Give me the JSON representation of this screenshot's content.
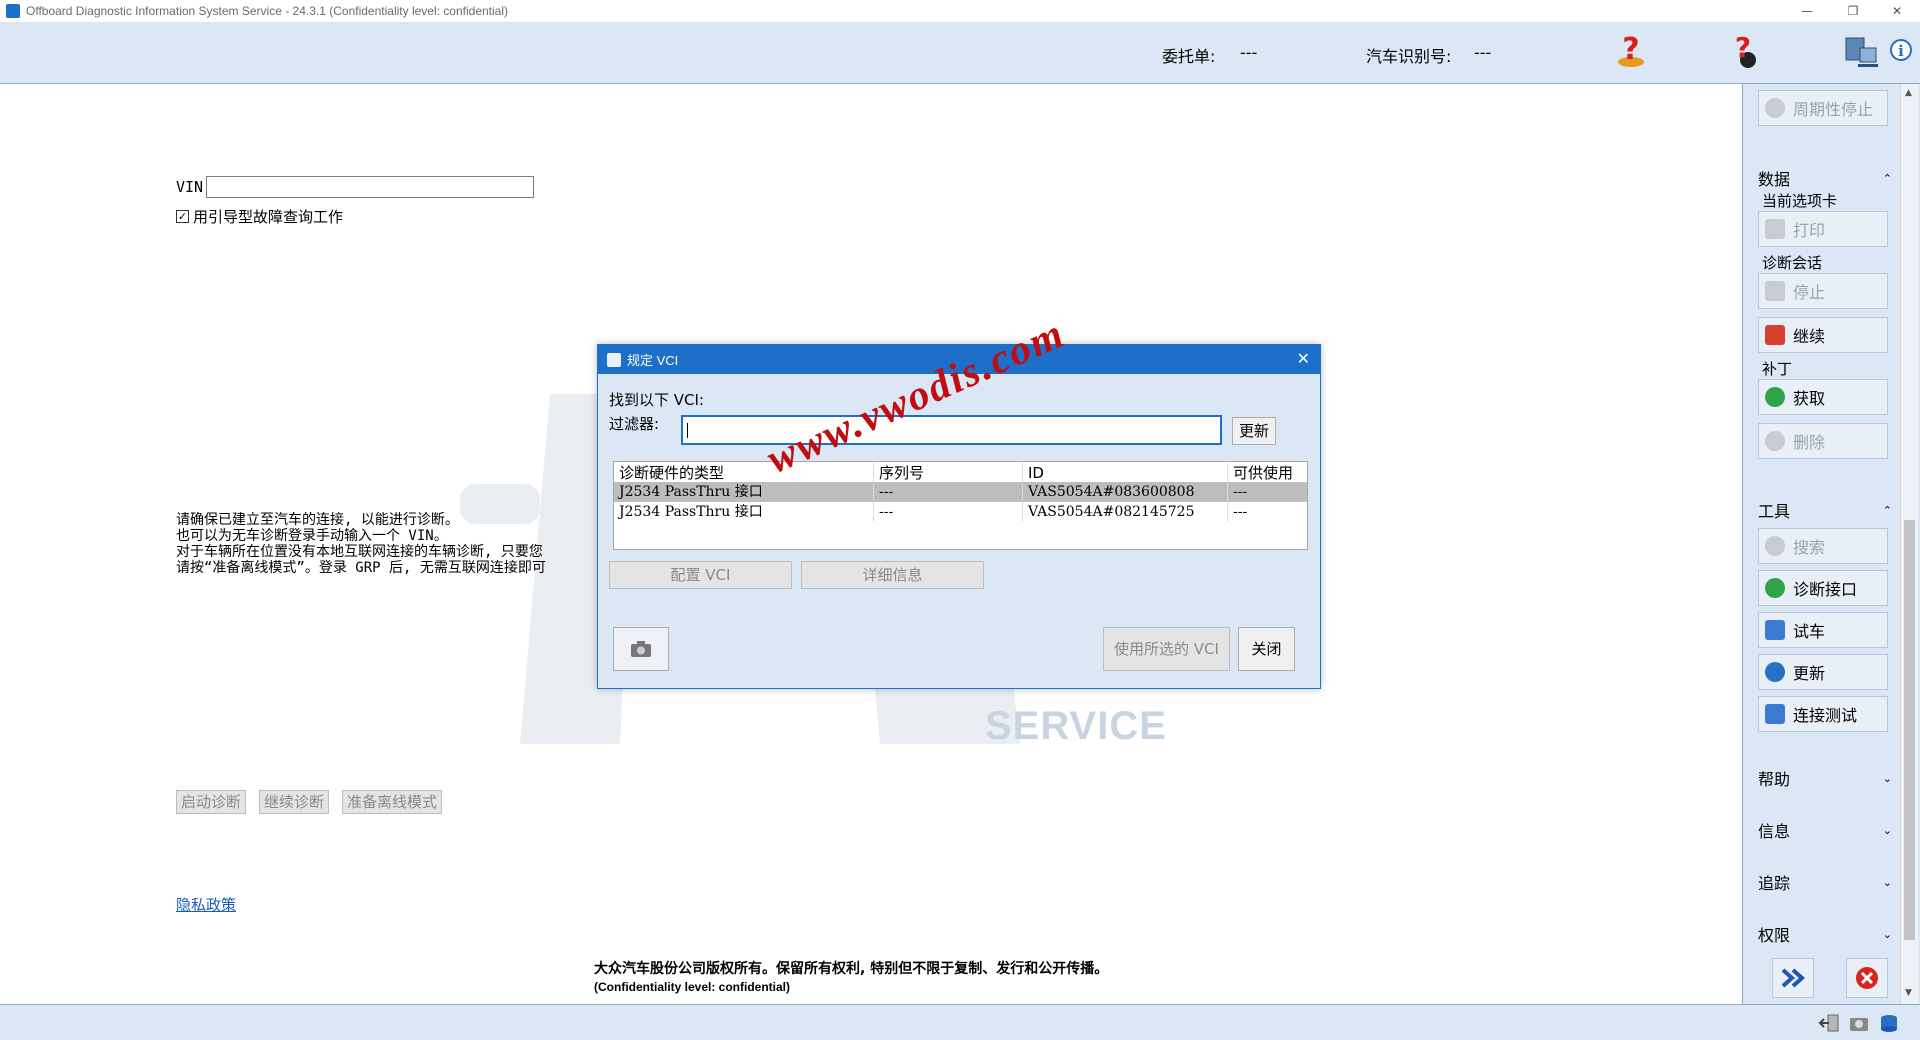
{
  "window": {
    "title": "Offboard Diagnostic Information System Service - 24.3.1 (Confidentiality level: confidential)"
  },
  "header": {
    "order_label": "委托单:",
    "order_value": "---",
    "vin_label": "汽车识别号:",
    "vin_value": "---"
  },
  "main": {
    "vin_field_label": "VIN",
    "vin_value": "",
    "guided_fault_label": "用引导型故障查询工作",
    "guided_fault_checked": true,
    "info_lines": [
      "请确保已建立至汽车的连接, 以能进行诊断。",
      "也可以为无车诊断登录手动输入一个 VIN。",
      "对于车辆所在位置没有本地互联网连接的车辆诊断, 只要您",
      "请按“准备离线模式”。登录 GRP 后, 无需互联网连接即可"
    ],
    "buttons": {
      "start": "启动诊断",
      "continue": "继续诊断",
      "offline": "准备离线模式"
    },
    "privacy_link": "隐私政策",
    "copyright": "大众汽车股份公司版权所有。保留所有权利, 特别但不限于复制、发行和公开传播。",
    "confidentiality": "(Confidentiality level: confidential)",
    "service_watermark": "SERVICE"
  },
  "overlay": {
    "watermark_text": "www.vwodis.com"
  },
  "sidebar": {
    "periodic_stop": "周期性停止",
    "data_section": "数据",
    "current_tab": "当前选项卡",
    "print": "打印",
    "diag_session": "诊断会话",
    "stop": "停止",
    "continue": "继续",
    "patch": "补丁",
    "fetch": "获取",
    "delete": "删除",
    "tools_section": "工具",
    "search": "搜索",
    "diag_interface": "诊断接口",
    "test_drive": "试车",
    "update": "更新",
    "connection_test": "连接测试",
    "help_section": "帮助",
    "info_section": "信息",
    "trace_section": "追踪",
    "rights_section": "权限"
  },
  "dialog": {
    "title": "规定 VCI",
    "found_label": "找到以下 VCI:",
    "filter_label": "过滤器:",
    "filter_value": "",
    "update_button": "更新",
    "columns": [
      "诊断硬件的类型",
      "序列号",
      "ID",
      "可供使用"
    ],
    "rows": [
      {
        "type": "J2534 PassThru 接口",
        "serial": "---",
        "id": "VAS5054A#083600808",
        "available": "---",
        "selected": true
      },
      {
        "type": "J2534 PassThru 接口",
        "serial": "---",
        "id": "VAS5054A#082145725",
        "available": "---",
        "selected": false
      }
    ],
    "configure_button": "配置 VCI",
    "details_button": "详细信息",
    "use_selected_button": "使用所选的 VCI",
    "close_button": "关闭"
  },
  "colors": {
    "accent": "#1e6fc9",
    "panel_bg": "#dbe7f4",
    "selection": "#bdbdbd",
    "watermark_red": "#c00d12"
  }
}
